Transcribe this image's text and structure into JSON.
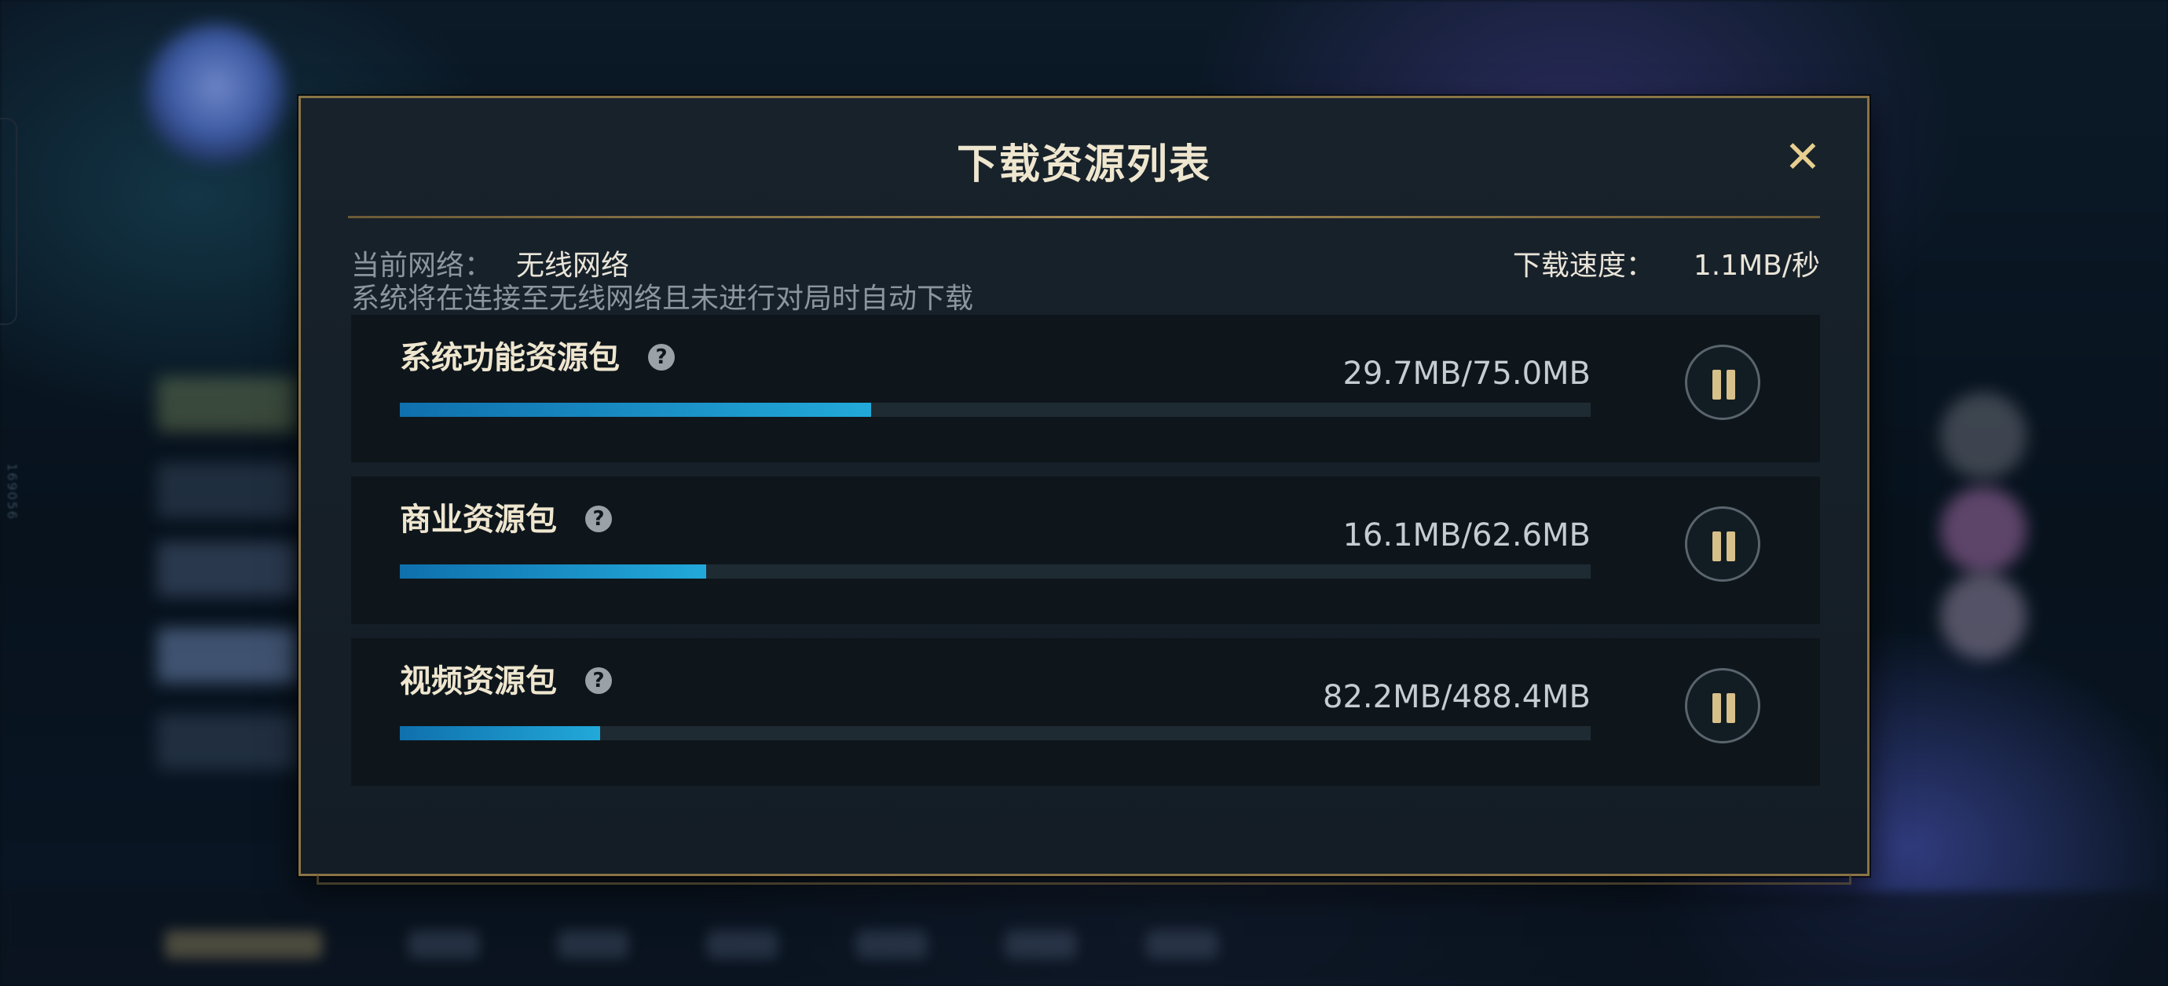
{
  "dialog": {
    "title": "下载资源列表",
    "close_label": "✕"
  },
  "network": {
    "label": "当前网络：",
    "value": "无线网络",
    "note": "系统将在连接至无线网络且未进行对局时自动下载"
  },
  "speed": {
    "label": "下载速度：",
    "value": "1.1MB/秒"
  },
  "resources": [
    {
      "name": "系统功能资源包",
      "help": "?",
      "size": "29.7MB/75.0MB",
      "progress": 0.396
    },
    {
      "name": "商业资源包",
      "help": "?",
      "size": "16.1MB/62.6MB",
      "progress": 0.257
    },
    {
      "name": "视频资源包",
      "help": "?",
      "size": "82.2MB/488.4MB",
      "progress": 0.168
    }
  ],
  "background_side_text": "169056",
  "colors": {
    "accent_gold": "#e8cf90",
    "border_gold": "#8a7447",
    "progress_start": "#0f70ad",
    "progress_end": "#22a9d9"
  },
  "icons": {
    "close": "close-icon",
    "help": "question-circle-icon",
    "pause": "pause-icon"
  }
}
